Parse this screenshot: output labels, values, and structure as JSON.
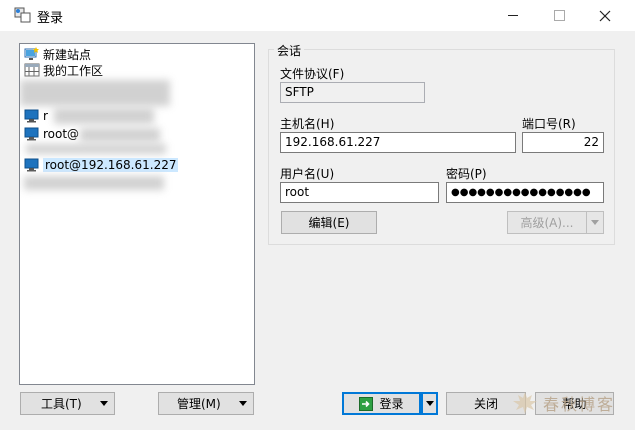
{
  "window": {
    "title": "登录"
  },
  "sites": {
    "new_site": "新建站点",
    "workspace": "我的工作区",
    "selected_site": "root@192.168.61.227",
    "partial_site_prefix": "r",
    "partial_site_2": "root@"
  },
  "session": {
    "group_title": "会话",
    "protocol_label": "文件协议(F)",
    "protocol_value": "SFTP",
    "host_label": "主机名(H)",
    "host_value": "192.168.61.227",
    "port_label": "端口号(R)",
    "port_value": "22",
    "user_label": "用户名(U)",
    "user_value": "root",
    "password_label": "密码(P)",
    "password_value": "●●●●●●●●●●●●●●●●",
    "edit_button": "编辑(E)",
    "advanced_button": "高级(A)..."
  },
  "footer": {
    "tools_button": "工具(T)",
    "manage_button": "管理(M)",
    "login_button": "登录",
    "close_button": "关闭",
    "help_button": "帮助"
  },
  "watermark": {
    "text": "春秋博客"
  },
  "colors": {
    "accent": "#0078d7",
    "selection": "#cce8ff",
    "login_icon": "#2ea043"
  }
}
